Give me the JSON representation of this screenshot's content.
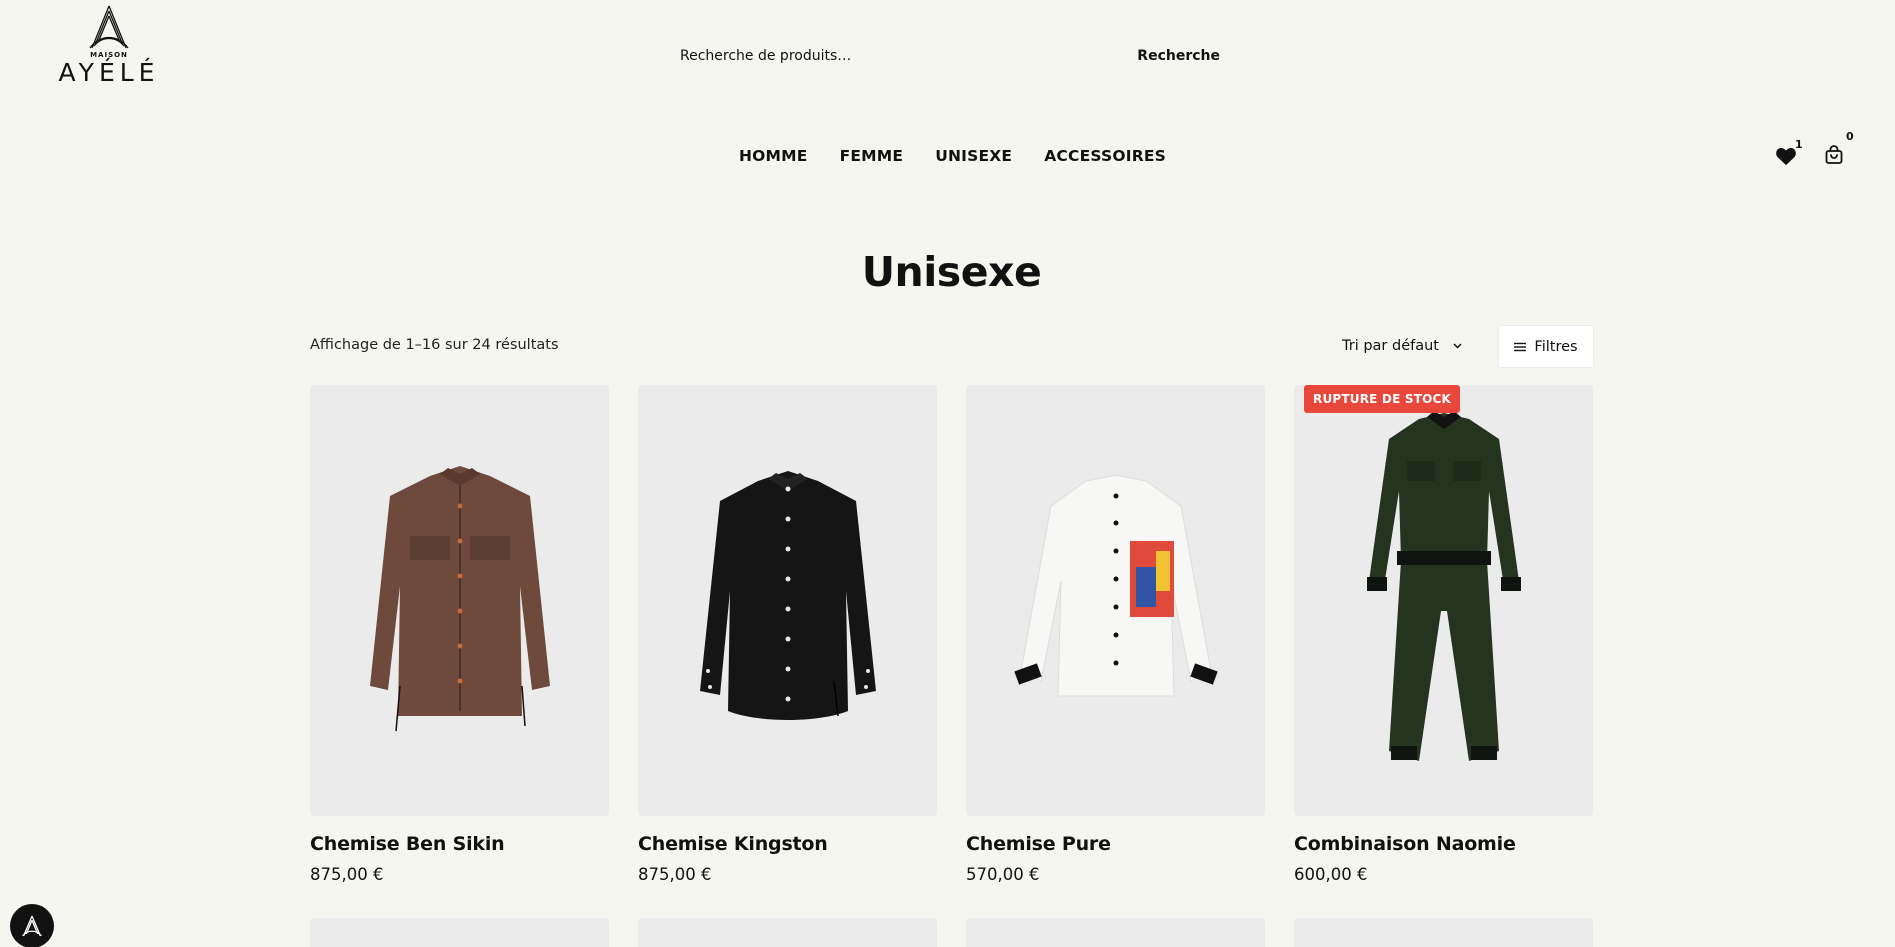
{
  "brand": {
    "maison": "MAISON",
    "name": "AYÉLÉ"
  },
  "search": {
    "placeholder": "Recherche de produits…",
    "button_label": "Recherche"
  },
  "nav": {
    "items": [
      "HOMME",
      "FEMME",
      "UNISEXE",
      "ACCESSOIRES"
    ]
  },
  "header_icons": {
    "wishlist_count": "1",
    "cart_count": "0",
    "wishlist_icon": "heart-icon",
    "cart_icon": "shopping-bag-icon"
  },
  "page": {
    "title": "Unisexe"
  },
  "toolbar": {
    "result_count": "Affichage de 1–16 sur 24 résultats",
    "sort_label": "Tri par défaut",
    "filter_label": "Filtres"
  },
  "products": [
    {
      "name": "Chemise Ben Sikin",
      "price": "875,00 €",
      "badge": "",
      "color": "#6e4a3c"
    },
    {
      "name": "Chemise Kingston",
      "price": "875,00 €",
      "badge": "",
      "color": "#151515"
    },
    {
      "name": "Chemise Pure",
      "price": "570,00 €",
      "badge": "",
      "color": "#f4f4f2"
    },
    {
      "name": "Combinaison Naomie",
      "price": "600,00 €",
      "badge": "RUPTURE DE STOCK",
      "color": "#24341f"
    }
  ],
  "colors": {
    "background": "#f6f6f1",
    "card_bg": "#ebebeb",
    "badge": "#e8473b"
  }
}
